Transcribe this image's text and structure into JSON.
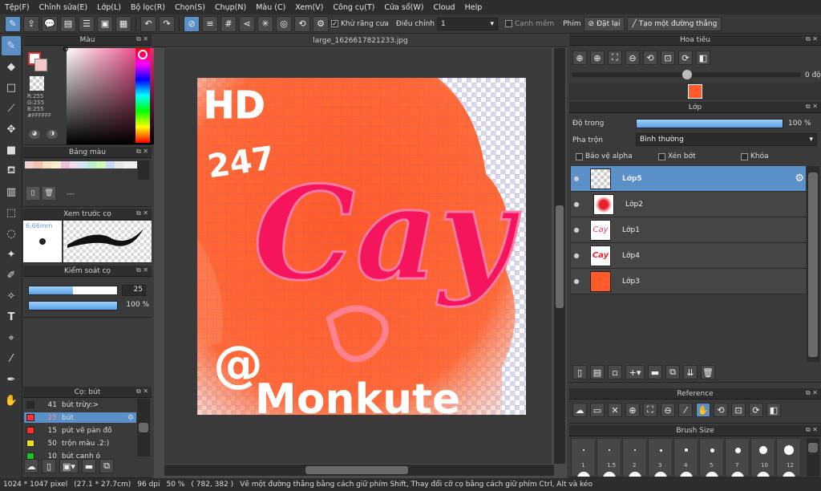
{
  "menu": [
    "Tệp(F)",
    "Chỉnh sửa(E)",
    "Lớp(L)",
    "Bộ lọc(R)",
    "Chọn(S)",
    "Chụp(N)",
    "Màu (C)",
    "Xem(V)",
    "Công cụ(T)",
    "Cửa sổ(W)",
    "Cloud",
    "Help"
  ],
  "toolbar": {
    "antialias_label": "Khử răng cưa",
    "adjust_label": "Điều chỉnh",
    "adjust_value": "1",
    "smooth_label": "Cạnh mềm",
    "key_label": "Phím",
    "reset_label": "Đặt lại",
    "line_label": "Tạo một đường thẳng"
  },
  "color_panel": {
    "title": "Màu",
    "r": "R:255",
    "g": "G:255",
    "b": "B:255",
    "hex": "#FFFFFF"
  },
  "palette_panel": {
    "title": "Bảng màu",
    "dots": "---"
  },
  "preview_panel": {
    "title": "Xem trước cọ",
    "size": "6.66mm"
  },
  "brush_ctrl": {
    "title": "Kiểm soát cọ",
    "size_value": "25",
    "opacity_value": "100 %"
  },
  "brush_list": {
    "title": "Cọ: bút",
    "items": [
      {
        "num": "41",
        "name": "bút trừy:>",
        "color": "#2a2a2a"
      },
      {
        "num": "25",
        "name": "bút",
        "color": "#ff3030",
        "selected": true
      },
      {
        "num": "15",
        "name": "pút vẽ pàn đồ",
        "color": "#ff3030"
      },
      {
        "num": "50",
        "name": "trộn màu .2:)",
        "color": "#e8e020"
      },
      {
        "num": "10",
        "name": "bút canh ó",
        "color": "#20c020"
      }
    ]
  },
  "document": {
    "tab": "large_1626617821233.jpg"
  },
  "navigator": {
    "title": "Hoa tiêu",
    "rotation": "0 độ"
  },
  "layer_panel": {
    "title": "Lớp",
    "opacity_label": "Độ trong",
    "opacity_value": "100 %",
    "opacity_fraction": 1.0,
    "blend_label": "Pha trộn",
    "blend_value": "Bình thường",
    "protect_alpha": "Bảo vệ alpha",
    "clipping": "Xén bớt",
    "lock": "Khóa"
  },
  "layers": [
    {
      "name": "Lớp5",
      "selected": true
    },
    {
      "name": "Lớp2"
    },
    {
      "name": "Lớp1"
    },
    {
      "name": "Lớp4"
    },
    {
      "name": "Lớp3"
    }
  ],
  "reference": {
    "title": "Reference"
  },
  "brush_size": {
    "title": "Brush Size",
    "labels": [
      "1",
      "1.5",
      "2",
      "3",
      "4",
      "5",
      "7",
      "10",
      "12"
    ]
  },
  "art": {
    "text1": "HD",
    "text2": "247",
    "text3": "Cay",
    "text4": "@",
    "text5": "Monkute"
  },
  "status": {
    "size": "1024 * 1047 pixel",
    "cm": "(27.1 * 27.7cm)",
    "dpi": "96 dpi",
    "zoom": "50 %",
    "coord": "( 782, 382 )",
    "hint": "Vẽ một đường thẳng bằng cách giữ phím Shift, Thay đổi cỡ cọ bằng cách giữ phím Ctrl, Alt và kéo"
  }
}
